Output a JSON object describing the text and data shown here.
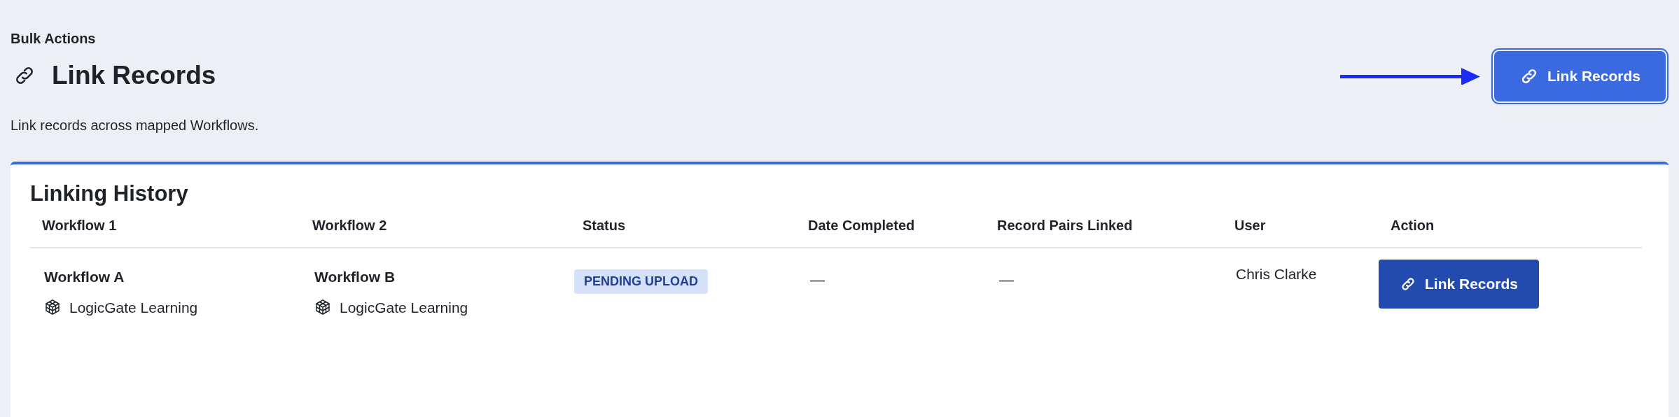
{
  "header": {
    "section": "Bulk Actions",
    "title": "Link Records",
    "description": "Link records across mapped Workflows."
  },
  "primary_button": {
    "label": "Link Records",
    "focused": true
  },
  "history": {
    "title": "Linking History",
    "columns": [
      "Workflow 1",
      "Workflow 2",
      "Status",
      "Date Completed",
      "Record Pairs Linked",
      "User",
      "Action"
    ],
    "rows": [
      {
        "workflow_1": {
          "name": "Workflow A",
          "app": "LogicGate Learning"
        },
        "workflow_2": {
          "name": "Workflow B",
          "app": "LogicGate Learning"
        },
        "status": "PENDING UPLOAD",
        "date_completed": "—",
        "record_pairs_linked": "—",
        "user": "Chris Clarke",
        "action": "Link Records"
      }
    ]
  }
}
